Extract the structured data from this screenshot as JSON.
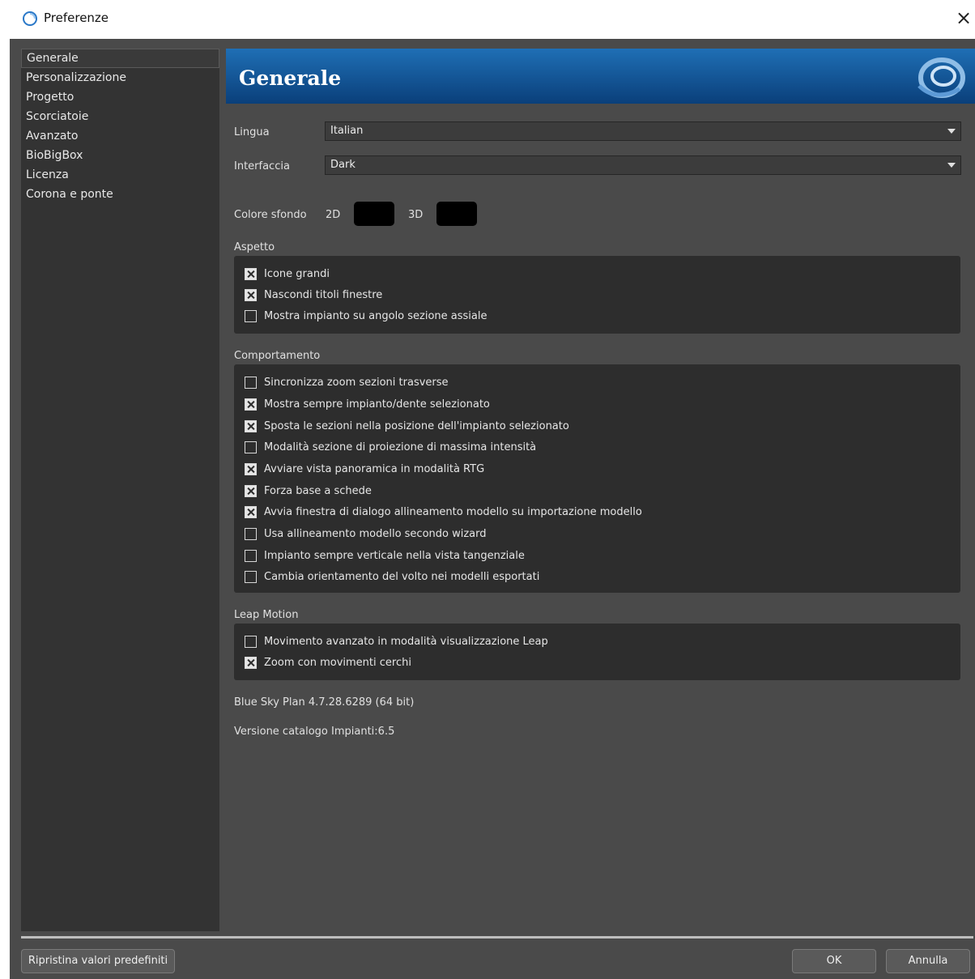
{
  "window": {
    "title": "Preferenze",
    "close_glyph": "×",
    "app_icon": "swirl-icon"
  },
  "sidebar": {
    "items": [
      {
        "label": "Generale",
        "selected": true
      },
      {
        "label": "Personalizzazione"
      },
      {
        "label": "Progetto"
      },
      {
        "label": "Scorciatoie"
      },
      {
        "label": "Avanzato"
      },
      {
        "label": "BioBigBox"
      },
      {
        "label": "Licenza"
      },
      {
        "label": "Corona e ponte"
      }
    ]
  },
  "header": {
    "title": "Generale",
    "logo": "swirl-logo-icon",
    "gradient_top": "#1f6fb5",
    "gradient_bottom": "#0a3f7a"
  },
  "general": {
    "language_label": "Lingua",
    "language_value": "Italian",
    "interface_label": "Interfaccia",
    "interface_value": "Dark",
    "bg_label": "Colore sfondo",
    "bg_2d_label": "2D",
    "bg_3d_label": "3D",
    "bg_2d_color": "#000000",
    "bg_3d_color": "#000000"
  },
  "aspetto": {
    "title": "Aspetto",
    "options": [
      {
        "label": "Icone grandi",
        "checked": true
      },
      {
        "label": "Nascondi titoli finestre",
        "checked": true
      },
      {
        "label": "Mostra impianto su angolo sezione assiale",
        "checked": false
      }
    ]
  },
  "comportamento": {
    "title": "Comportamento",
    "options": [
      {
        "label": "Sincronizza zoom sezioni trasverse",
        "checked": false
      },
      {
        "label": "Mostra sempre impianto/dente selezionato",
        "checked": true
      },
      {
        "label": "Sposta le sezioni nella posizione dell'impianto selezionato",
        "checked": true
      },
      {
        "label": "Modalità sezione di proiezione di massima intensità",
        "checked": false
      },
      {
        "label": "Avviare vista panoramica in modalità RTG",
        "checked": true
      },
      {
        "label": "Forza base a schede",
        "checked": true
      },
      {
        "label": "Avvia finestra di dialogo allineamento modello su importazione modello",
        "checked": true
      },
      {
        "label": "Usa allineamento modello secondo wizard",
        "checked": false
      },
      {
        "label": "Impianto sempre verticale nella vista tangenziale",
        "checked": false
      },
      {
        "label": "Cambia orientamento del volto nei modelli esportati",
        "checked": false
      }
    ]
  },
  "leap": {
    "title": "Leap Motion",
    "options": [
      {
        "label": "Movimento avanzato in modalità visualizzazione Leap",
        "checked": false
      },
      {
        "label": "Zoom con movimenti cerchi",
        "checked": true
      }
    ]
  },
  "info": {
    "version": "Blue Sky Plan 4.7.28.6289 (64 bit)",
    "catalog": "Versione catalogo Impianti:6.5"
  },
  "footer": {
    "reset_label": "Ripristina valori predefiniti",
    "ok_label": "OK",
    "cancel_label": "Annulla"
  }
}
